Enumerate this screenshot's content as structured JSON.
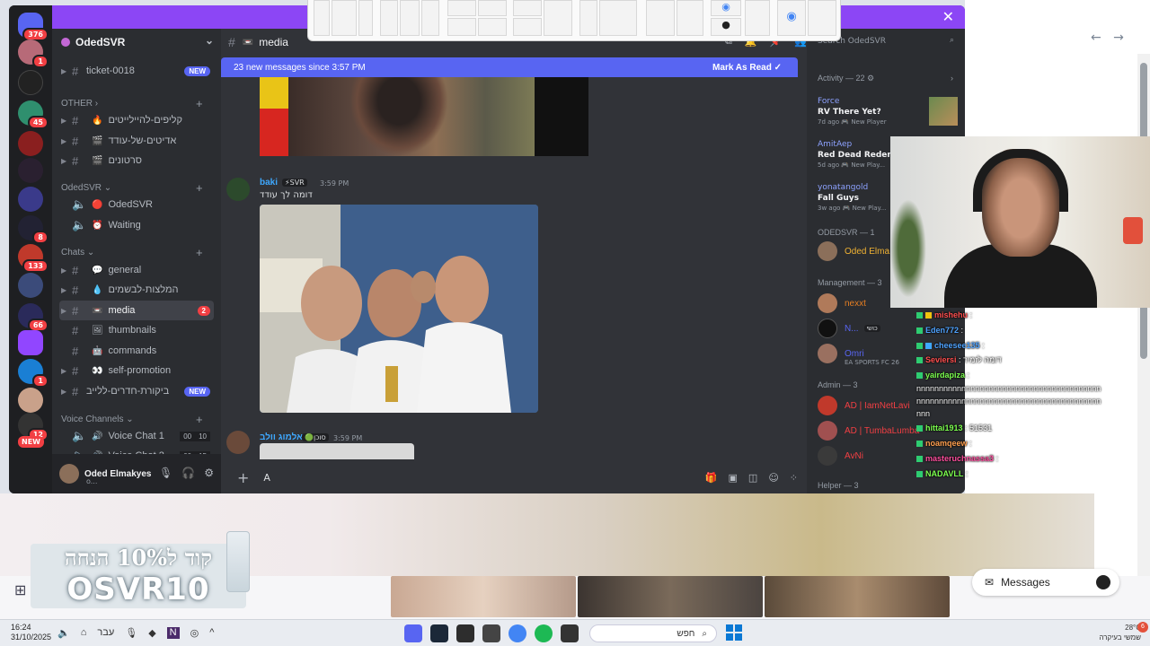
{
  "colors": {
    "accent": "#5865f2",
    "brand_bar": "#8c46f5",
    "danger": "#f23f43",
    "online": "#23a55a"
  },
  "server": {
    "name": "OdedSVR"
  },
  "servers_rail": {
    "badges": [
      "376",
      "1",
      "45",
      "8",
      "133",
      "66",
      "1",
      "12"
    ],
    "new_label": "NEW"
  },
  "channels": {
    "top": [
      {
        "name": "ticket-0018",
        "badge": "NEW"
      }
    ],
    "other_label": "OTHER",
    "other": [
      {
        "emoji": "🔥",
        "name": "קליפים-להיילייטים"
      },
      {
        "emoji": "🎬",
        "name": "אדיטים-של-עודד"
      },
      {
        "emoji": "🎬",
        "name": "סרטונים"
      }
    ],
    "odedsvr_label": "OdedSVR",
    "voice_top": [
      {
        "emoji": "🔴",
        "name": "OdedSVR"
      },
      {
        "emoji": "⏰",
        "name": "Waiting"
      }
    ],
    "chats_label": "Chats",
    "chats": [
      {
        "emoji": "💬",
        "name": "general"
      },
      {
        "emoji": "💧",
        "name": "המלצות-לבשמים"
      },
      {
        "emoji": "📼",
        "name": "media",
        "count": "2"
      },
      {
        "emoji": "🖼",
        "name": "thumbnails"
      },
      {
        "emoji": "🤖",
        "name": "commands"
      },
      {
        "emoji": "👀",
        "name": "self-promotion"
      },
      {
        "emoji": "",
        "name": "ביקורת-חדרים-ללייב",
        "badge": "NEW"
      }
    ],
    "voice_label": "Voice Channels",
    "voice": [
      {
        "emoji": "🔊",
        "name": "Voice Chat 1",
        "a": "00",
        "b": "10"
      },
      {
        "emoji": "🔊",
        "name": "Voice Chat 2",
        "a": "00",
        "b": "15"
      }
    ]
  },
  "user": {
    "name": "Oded Elmakyes",
    "status": "o..."
  },
  "main": {
    "channel": "media",
    "channel_emoji": "📼",
    "new_messages": "23 new messages since 3:57 PM",
    "mark_read": "Mark As Read",
    "messages": [
      {
        "author": "baki",
        "tag": "⚡SVR",
        "time": "3:59 PM",
        "text": "דומה לך עודד"
      },
      {
        "author": "אלמוג וולב",
        "tag": "🟢סוכן",
        "time": "3:59 PM",
        "text": ""
      }
    ],
    "composer_placeholder": "A"
  },
  "members": {
    "search": "Search OdedSVR",
    "activity_label": "Activity — 22",
    "activity": [
      {
        "user": "Force",
        "game": "RV There Yet?",
        "meta": "7d ago",
        "tag": "New Player"
      },
      {
        "user": "AmitAep",
        "game": "Red Dead Redempti...",
        "meta": "5d ago",
        "tag": "New Play..."
      },
      {
        "user": "yonatangold",
        "game": "Fall Guys",
        "meta": "3w ago",
        "tag": "New Play..."
      }
    ],
    "groups": [
      {
        "label": "ODEDSVR — 1",
        "members": [
          {
            "name": "Oded Elma...",
            "color": "#f0b232"
          }
        ]
      },
      {
        "label": "Management — 3",
        "members": [
          {
            "name": "nexxt",
            "color": "#e67e22"
          },
          {
            "name": "N...",
            "color": "#5865f2",
            "tag": "כושי"
          },
          {
            "name": "Omri",
            "color": "#5865f2",
            "sub": "EA SPORTS FC 26"
          }
        ]
      },
      {
        "label": "Admin — 3",
        "members": [
          {
            "name": "AD | IamNetLavi",
            "color": "#f23f43"
          },
          {
            "name": "AD | TumbaLumba",
            "color": "#f23f43"
          },
          {
            "name": "AvNi",
            "color": "#f23f43"
          }
        ]
      },
      {
        "label": "Helper — 3",
        "members": []
      }
    ]
  },
  "twitch_chat": [
    {
      "user": "mishehu",
      "color": "#ff4f4f",
      "msg": ":"
    },
    {
      "user": "Eden772",
      "color": "#4fa3ff",
      "msg": ":"
    },
    {
      "user": "cheesee135",
      "color": "#4fa3ff",
      "msg": ":"
    },
    {
      "user": "Seviersi",
      "color": "#ff4f4f",
      "msg": ": דומה לזמיר"
    },
    {
      "user": "yairdapiza",
      "color": "#7cff4f",
      "msg": ":"
    },
    {
      "user": "",
      "color": "#fff",
      "msg": "nnnnnnnnnnnnnnnnnnnnnnnnnnnnnnnnnnnnnnnnn"
    },
    {
      "user": "",
      "color": "#fff",
      "msg": "nnnnnnnnnnnnnnnnnnnnnnnnnnnnnnnnnnnnnnnnn"
    },
    {
      "user": "",
      "color": "#fff",
      "msg": "nnn"
    },
    {
      "user": "hittai1913",
      "color": "#7cff4f",
      "msg": ": 51531"
    },
    {
      "user": "noamqeew",
      "color": "#ff9f4f",
      "msg": ":"
    },
    {
      "user": "masteruchnassa3",
      "color": "#ff4f9f",
      "msg": ":"
    },
    {
      "user": "NADAVLL",
      "color": "#7cff4f",
      "msg": ":"
    }
  ],
  "promo": {
    "line1": "קוד ל10% הנחה",
    "line2": "OSVR10"
  },
  "messages_pill": {
    "label": "Messages"
  },
  "taskbar": {
    "time": "16:24",
    "date": "31/10/2025",
    "lang": "עבר",
    "search": "חפש",
    "temp": "28°C",
    "weather": "שמשי בעיקרה",
    "notif": "6"
  }
}
